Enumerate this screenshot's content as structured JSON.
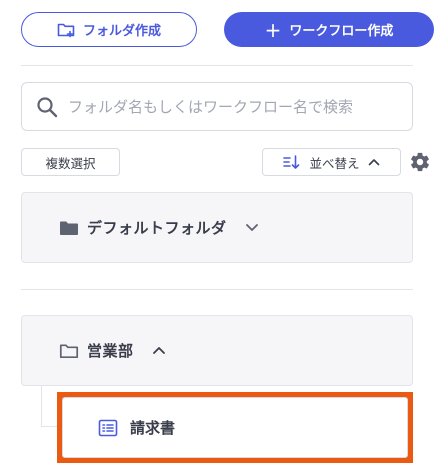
{
  "toolbar": {
    "create_folder_label": "フォルダ作成",
    "create_workflow_label": "ワークフロー作成",
    "plus_symbol": "+"
  },
  "search": {
    "placeholder": "フォルダ名もしくはワークフロー名で検索",
    "value": ""
  },
  "controls": {
    "multi_select_label": "複数選択",
    "sort_label": "並べ替え"
  },
  "folders": [
    {
      "label": "デフォルトフォルダ",
      "state": "collapsed",
      "icon": "folder-filled-icon"
    },
    {
      "label": "営業部",
      "state": "expanded",
      "icon": "folder-outline-icon"
    }
  ],
  "workflows": [
    {
      "label": "請求書",
      "icon": "list-document-icon",
      "selected": true
    }
  ],
  "colors": {
    "accent": "#4a5adf",
    "highlight": "#ea5a12",
    "text": "#3a3d4a",
    "icon_gray": "#5f6270"
  }
}
